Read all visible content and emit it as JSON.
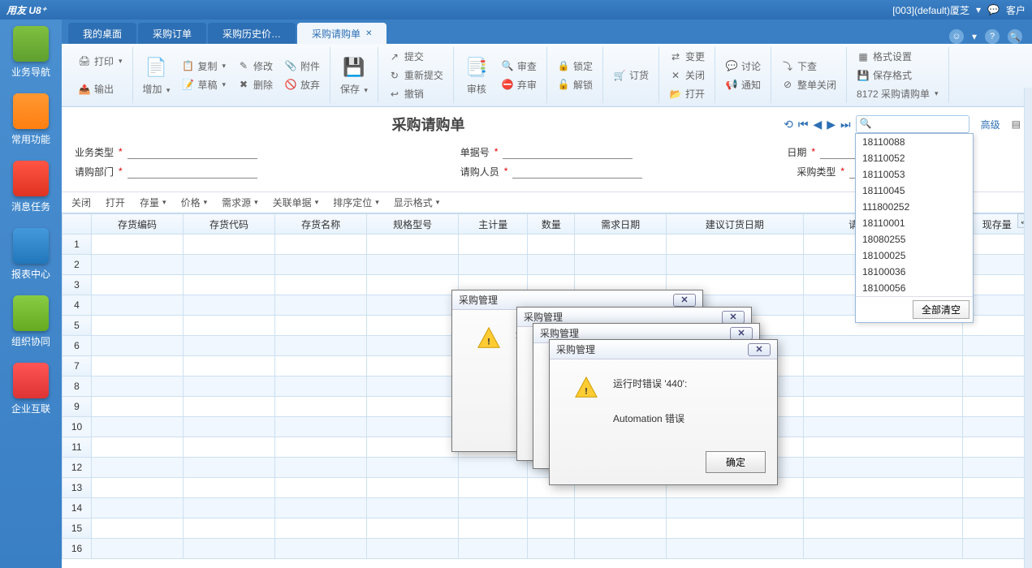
{
  "app_title": "用友 U8⁺",
  "titlebar_right": {
    "org": "[003](default)厦芝",
    "customer": "客户"
  },
  "sidebar": [
    {
      "label": "业务导航",
      "icon": "icon-nav",
      "name": "sidebar-business-nav"
    },
    {
      "label": "常用功能",
      "icon": "icon-fav",
      "name": "sidebar-common"
    },
    {
      "label": "消息任务",
      "icon": "icon-msg",
      "name": "sidebar-message"
    },
    {
      "label": "报表中心",
      "icon": "icon-rpt",
      "name": "sidebar-report"
    },
    {
      "label": "组织协同",
      "icon": "icon-org",
      "name": "sidebar-org"
    },
    {
      "label": "企业互联",
      "icon": "icon-ent",
      "name": "sidebar-enterprise"
    }
  ],
  "tabs": [
    {
      "label": "我的桌面",
      "active": false,
      "name": "tab-desktop"
    },
    {
      "label": "采购订单",
      "active": false,
      "name": "tab-po"
    },
    {
      "label": "采购历史价…",
      "active": false,
      "name": "tab-history"
    },
    {
      "label": "采购请购单",
      "active": true,
      "name": "tab-pr"
    }
  ],
  "ribbon": {
    "print": "打印",
    "output": "输出",
    "add": "增加",
    "copy": "复制",
    "draft": "草稿",
    "modify": "修改",
    "delete": "删除",
    "attach": "附件",
    "discard": "放弃",
    "save": "保存",
    "submit": "提交",
    "resubmit": "重新提交",
    "revoke": "撤销",
    "review": "审核",
    "check": "审查",
    "abandon": "弃审",
    "lock": "锁定",
    "unlock": "解锁",
    "order": "订货",
    "change": "变更",
    "close": "关闭",
    "open": "打开",
    "discuss": "讨论",
    "notify": "通知",
    "down": "下查",
    "wholeclose": "整单关闭",
    "format": "格式设置",
    "saveformat": "保存格式",
    "docno": "8172 采购请购单"
  },
  "doc": {
    "title": "采购请购单",
    "advanced": "高级",
    "fields": {
      "biztype": "业务类型",
      "docno": "单据号",
      "date": "日期",
      "dept": "请购部门",
      "person": "请购人员",
      "ptype": "采购类型"
    }
  },
  "sub_toolbar": [
    "关闭",
    "打开",
    "存量",
    "价格",
    "需求源",
    "关联单据",
    "排序定位",
    "显示格式"
  ],
  "table": {
    "cols": [
      "存货编码",
      "存货代码",
      "存货名称",
      "规格型号",
      "主计量",
      "数量",
      "需求日期",
      "建议订货日期",
      "请购未完成数量",
      "现存量"
    ],
    "rows": 16
  },
  "dropdown": {
    "items": [
      "18110088",
      "18110052",
      "18110053",
      "18110045",
      "111800252",
      "18110001",
      "18080255",
      "18100025",
      "18100036",
      "18100056"
    ],
    "clear": "全部清空"
  },
  "dialogs": {
    "title": "采购管理",
    "line1": "运行时错误 '440':",
    "line2": "Automation 错误",
    "partial": "运",
    "ok": "确定"
  }
}
